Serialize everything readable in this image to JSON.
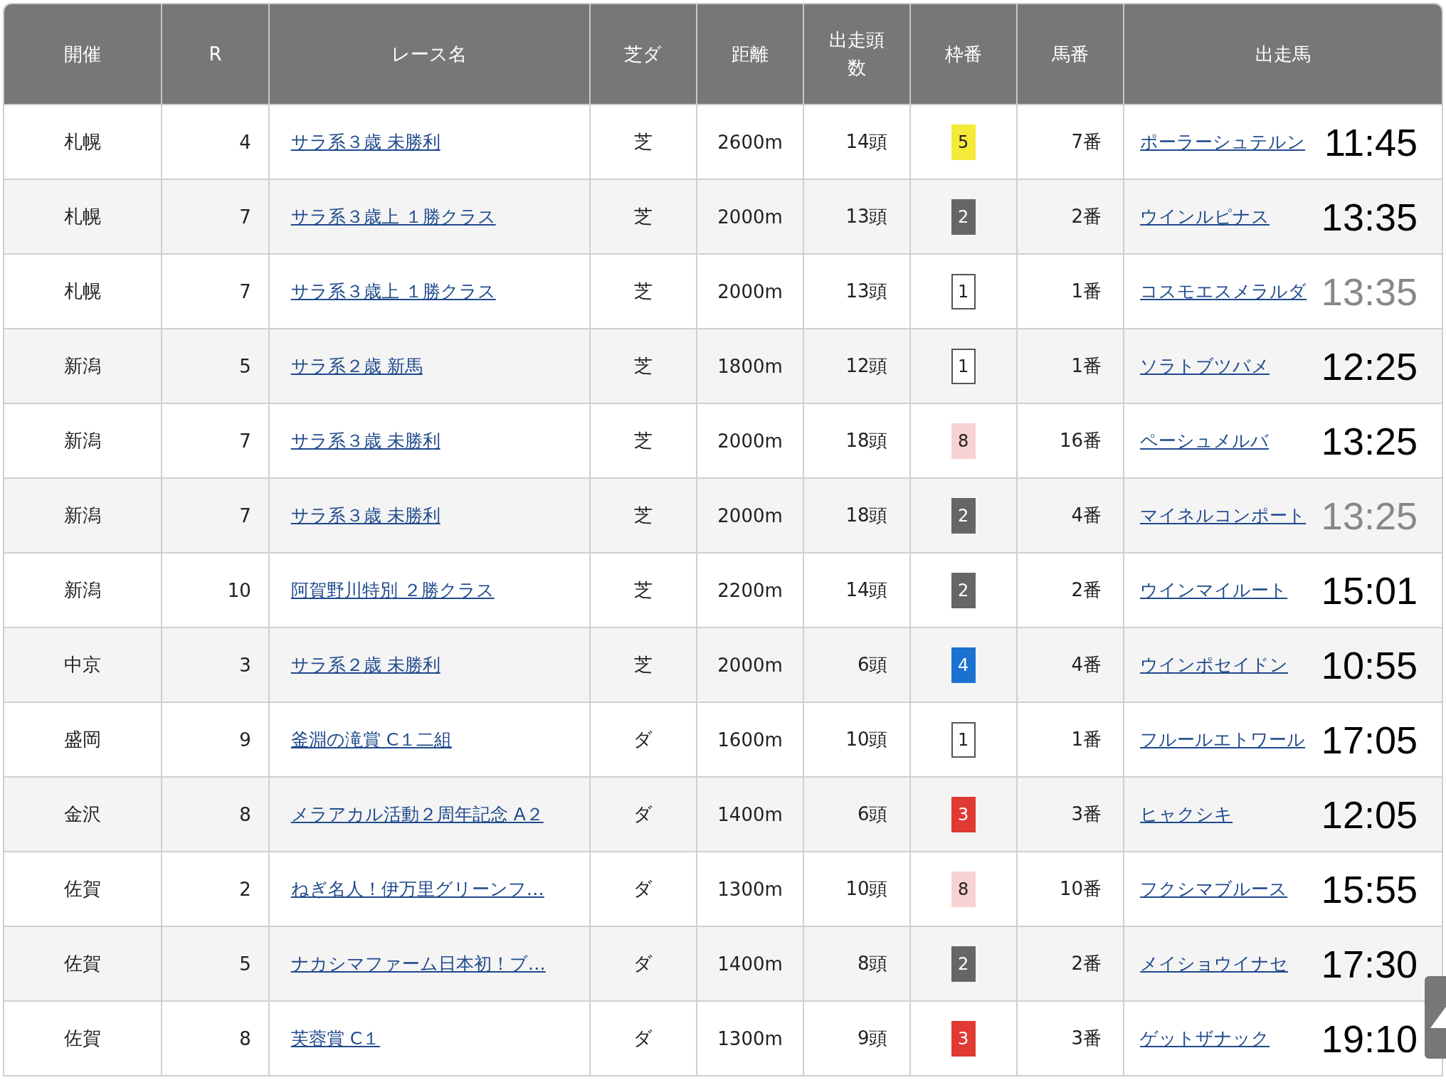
{
  "table": {
    "columns": [
      "開催",
      "R",
      "レース名",
      "芝ダ",
      "距離",
      "出走頭数",
      "枠番",
      "馬番",
      "出走馬"
    ],
    "rows": [
      {
        "venue": "札幌",
        "race": "4",
        "race_name": "サラ系３歳 未勝利",
        "surface": "芝",
        "distance": "2600m",
        "runners": "14頭",
        "frame": {
          "number": "5",
          "color": "#f5e93a"
        },
        "horse_number": "7番",
        "horse": "ポーラーシュテルン",
        "time": {
          "text": "11:45",
          "dimmed": false
        }
      },
      {
        "venue": "札幌",
        "race": "7",
        "race_name": "サラ系３歳上 １勝クラス",
        "surface": "芝",
        "distance": "2000m",
        "runners": "13頭",
        "frame": {
          "number": "2",
          "color": "#666666"
        },
        "horse_number": "2番",
        "horse": "ウインルピナス",
        "time": {
          "text": "13:35",
          "dimmed": false
        }
      },
      {
        "venue": "札幌",
        "race": "7",
        "race_name": "サラ系３歳上 １勝クラス",
        "surface": "芝",
        "distance": "2000m",
        "runners": "13頭",
        "frame": {
          "number": "1",
          "color": "#ffffff"
        },
        "horse_number": "1番",
        "horse": "コスモエスメラルダ",
        "time": {
          "text": "13:35",
          "dimmed": true
        }
      },
      {
        "venue": "新潟",
        "race": "5",
        "race_name": "サラ系２歳 新馬",
        "surface": "芝",
        "distance": "1800m",
        "runners": "12頭",
        "frame": {
          "number": "1",
          "color": "#ffffff"
        },
        "horse_number": "1番",
        "horse": "ソラトブツバメ",
        "time": {
          "text": "12:25",
          "dimmed": false
        }
      },
      {
        "venue": "新潟",
        "race": "7",
        "race_name": "サラ系３歳 未勝利",
        "surface": "芝",
        "distance": "2000m",
        "runners": "18頭",
        "frame": {
          "number": "8",
          "color": "#f6d2d2"
        },
        "horse_number": "16番",
        "horse": "ペーシュメルバ",
        "time": {
          "text": "13:25",
          "dimmed": false
        }
      },
      {
        "venue": "新潟",
        "race": "7",
        "race_name": "サラ系３歳 未勝利",
        "surface": "芝",
        "distance": "2000m",
        "runners": "18頭",
        "frame": {
          "number": "2",
          "color": "#666666"
        },
        "horse_number": "4番",
        "horse": "マイネルコンポート",
        "time": {
          "text": "13:25",
          "dimmed": true
        }
      },
      {
        "venue": "新潟",
        "race": "10",
        "race_name": "阿賀野川特別 ２勝クラス",
        "surface": "芝",
        "distance": "2200m",
        "runners": "14頭",
        "frame": {
          "number": "2",
          "color": "#666666"
        },
        "horse_number": "2番",
        "horse": "ウインマイルート",
        "time": {
          "text": "15:01",
          "dimmed": false
        }
      },
      {
        "venue": "中京",
        "race": "3",
        "race_name": "サラ系２歳 未勝利",
        "surface": "芝",
        "distance": "2000m",
        "runners": "6頭",
        "frame": {
          "number": "4",
          "color": "#1a72d0"
        },
        "horse_number": "4番",
        "horse": "ウインポセイドン",
        "time": {
          "text": "10:55",
          "dimmed": false
        }
      },
      {
        "venue": "盛岡",
        "race": "9",
        "race_name": "釜淵の滝賞 C１二組",
        "surface": "ダ",
        "distance": "1600m",
        "runners": "10頭",
        "frame": {
          "number": "1",
          "color": "#ffffff"
        },
        "horse_number": "1番",
        "horse": "フルールエトワール",
        "time": {
          "text": "17:05",
          "dimmed": false
        }
      },
      {
        "venue": "金沢",
        "race": "8",
        "race_name": "メラアカル活動２周年記念 A２",
        "surface": "ダ",
        "distance": "1400m",
        "runners": "6頭",
        "frame": {
          "number": "3",
          "color": "#e03a32"
        },
        "horse_number": "3番",
        "horse": "ヒャクシキ",
        "time": {
          "text": "12:05",
          "dimmed": false
        }
      },
      {
        "venue": "佐賀",
        "race": "2",
        "race_name": "ねぎ名人！伊万里グリーンフ…",
        "surface": "ダ",
        "distance": "1300m",
        "runners": "10頭",
        "frame": {
          "number": "8",
          "color": "#f6d2d2"
        },
        "horse_number": "10番",
        "horse": "フクシマブルース",
        "time": {
          "text": "15:55",
          "dimmed": false
        }
      },
      {
        "venue": "佐賀",
        "race": "5",
        "race_name": "ナカシマファーム日本初！ブ…",
        "surface": "ダ",
        "distance": "1400m",
        "runners": "8頭",
        "frame": {
          "number": "2",
          "color": "#666666"
        },
        "horse_number": "2番",
        "horse": "メイショウイナセ",
        "time": {
          "text": "17:30",
          "dimmed": false
        }
      },
      {
        "venue": "佐賀",
        "race": "8",
        "race_name": "芙蓉賞 C１",
        "surface": "ダ",
        "distance": "1300m",
        "runners": "9頭",
        "frame": {
          "number": "3",
          "color": "#e03a32"
        },
        "horse_number": "3番",
        "horse": "ゲットザナック",
        "time": {
          "text": "19:10",
          "dimmed": false
        }
      }
    ]
  }
}
